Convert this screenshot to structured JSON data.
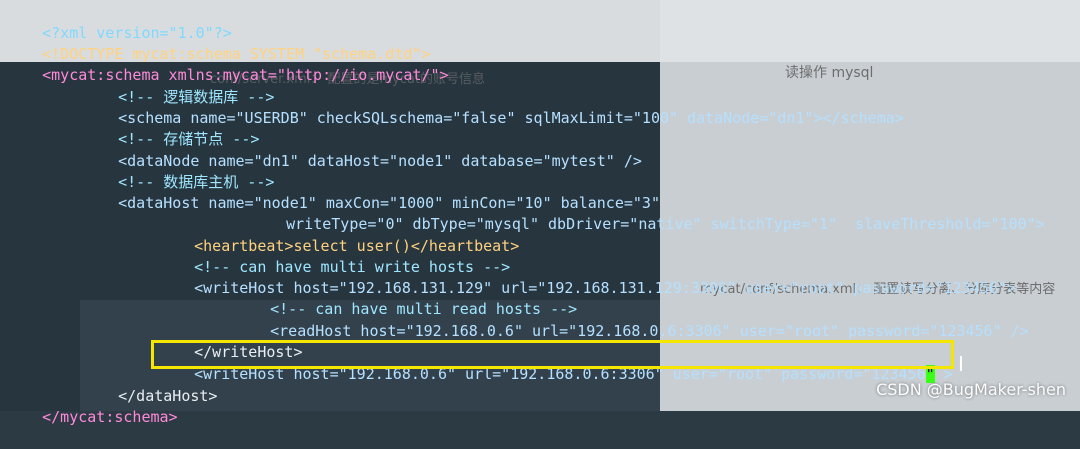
{
  "background_captions": {
    "top_right_1": "读操作 mysql",
    "top_right_2": "mycat/conf/schema.xml： 配置读写分离、分库分表等内容",
    "top_mid": "conf/server.xml： 配置的是mycat的账号信息"
  },
  "lines": [
    {
      "id": "xmldecl",
      "text": "<?xml version=\"1.0\"?>"
    },
    {
      "id": "doctype",
      "text": "<!DOCTYPE mycat:schema SYSTEM \"schema.dtd\">"
    },
    {
      "id": "schema_open",
      "text": "<mycat:schema xmlns:mycat=\"http://io.mycat/\">"
    },
    {
      "id": "c1",
      "text": "<!-- 逻辑数据库 -->"
    },
    {
      "id": "schema",
      "text": "<schema name=\"USERDB\" checkSQLschema=\"false\" sqlMaxLimit=\"100\" dataNode=\"dn1\"></schema>"
    },
    {
      "id": "c2",
      "text": "<!-- 存储节点 -->"
    },
    {
      "id": "datanode",
      "text": "<dataNode name=\"dn1\" dataHost=\"node1\" database=\"mytest\" />"
    },
    {
      "id": "c3",
      "text": "<!-- 数据库主机 -->"
    },
    {
      "id": "datahost",
      "text": "<dataHost name=\"node1\" maxCon=\"1000\" minCon=\"10\" balance=\"3\""
    },
    {
      "id": "datahost2",
      "text": "writeType=\"0\" dbType=\"mysql\" dbDriver=\"native\" switchType=\"1\"  slaveThreshold=\"100\">"
    },
    {
      "id": "heartbeat",
      "text": "<heartbeat>select user()</heartbeat>"
    },
    {
      "id": "c4",
      "text": "<!-- can have multi write hosts -->"
    },
    {
      "id": "writehost1",
      "text": "<writeHost host=\"192.168.131.129\" url=\"192.168.131.129:3306\" user=\"root\" password=\"123456\">"
    },
    {
      "id": "c5",
      "text": "<!-- can have multi read hosts -->"
    },
    {
      "id": "readhost",
      "text": "<readHost host=\"192.168.0.6\" url=\"192.168.0.6:3306\" user=\"root\" password=\"123456\" />"
    },
    {
      "id": "writehost1_close",
      "text": "</writeHost>"
    },
    {
      "id": "writehost2_pre",
      "text": "<writeHost host=\"192.168.0.6\" url=\"192.168.0.6:3306\" user=\"root\" password=\"123456"
    },
    {
      "id": "writehost2_cursor",
      "text": "\""
    },
    {
      "id": "writehost2_post",
      "text": " >"
    },
    {
      "id": "datahost_close",
      "text": "</dataHost>"
    },
    {
      "id": "schema_close",
      "text": "</mycat:schema>"
    }
  ],
  "watermark": "CSDN @BugMaker-shen",
  "colors": {
    "highlight": "#f5e600",
    "cursor": "#39ff14",
    "background": "#2c3a44"
  }
}
